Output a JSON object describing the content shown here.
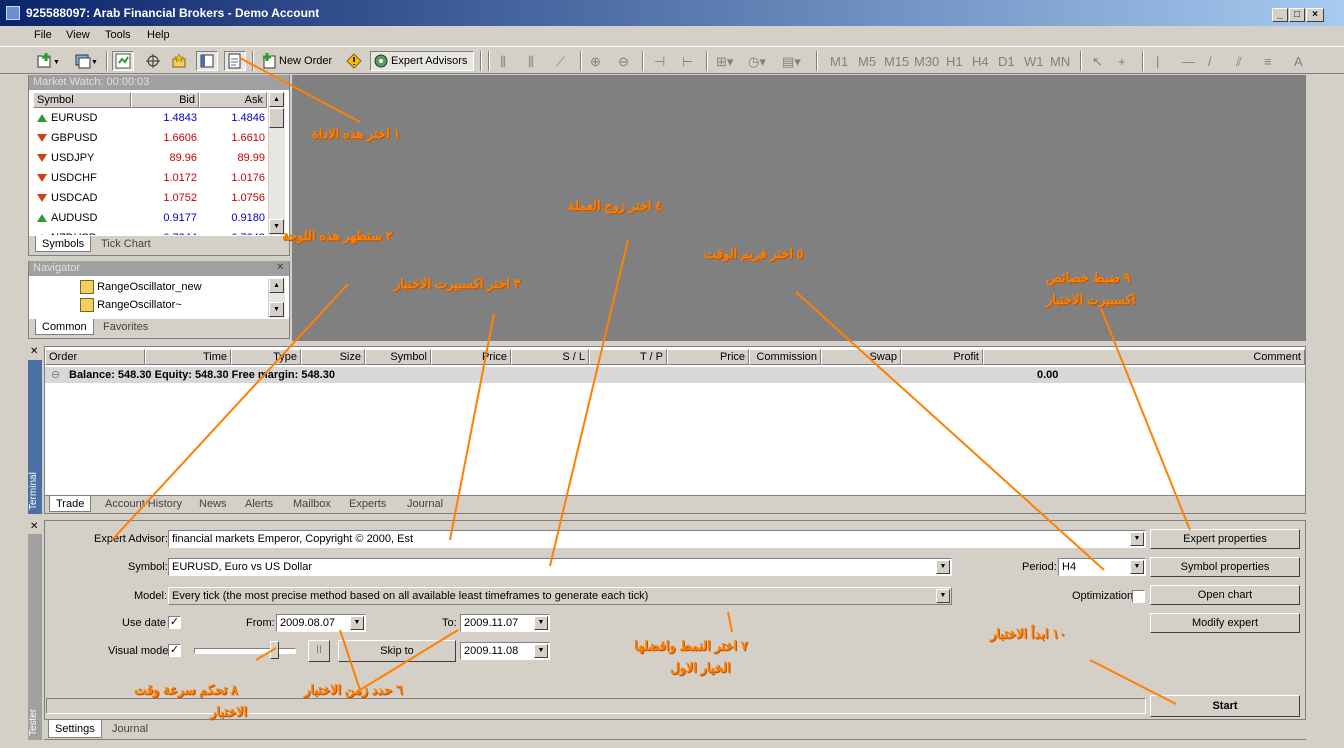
{
  "window": {
    "title": "925588097: Arab Financial Brokers - Demo Account",
    "min": "_",
    "max": "□",
    "close": "×"
  },
  "menu": [
    "File",
    "View",
    "Tools",
    "Help"
  ],
  "toolbar": {
    "new_order": "New Order",
    "expert_advisors": "Expert Advisors"
  },
  "market_watch": {
    "title": "Market Watch: 00:00:03",
    "headers": {
      "symbol": "Symbol",
      "bid": "Bid",
      "ask": "Ask"
    },
    "rows": [
      {
        "symbol": "EURUSD",
        "bid": "1.4843",
        "ask": "1.4846",
        "dir": "up"
      },
      {
        "symbol": "GBPUSD",
        "bid": "1.6606",
        "ask": "1.6610",
        "dir": "down"
      },
      {
        "symbol": "USDJPY",
        "bid": "89.96",
        "ask": "89.99",
        "dir": "down"
      },
      {
        "symbol": "USDCHF",
        "bid": "1.0172",
        "ask": "1.0176",
        "dir": "down"
      },
      {
        "symbol": "USDCAD",
        "bid": "1.0752",
        "ask": "1.0756",
        "dir": "down"
      },
      {
        "symbol": "AUDUSD",
        "bid": "0.9177",
        "ask": "0.9180",
        "dir": "up"
      },
      {
        "symbol": "NZDUSD",
        "bid": "0.7344",
        "ask": "0.7348",
        "dir": "up"
      }
    ],
    "tabs": [
      "Symbols",
      "Tick Chart"
    ]
  },
  "navigator": {
    "title": "Navigator",
    "items": [
      "RangeOscillator_new",
      "RangeOscillator~"
    ],
    "tabs": [
      "Common",
      "Favorites"
    ]
  },
  "terminal": {
    "title": "Terminal",
    "headers": [
      "Order",
      "Time",
      "Type",
      "Size",
      "Symbol",
      "Price",
      "S / L",
      "T / P",
      "Price",
      "Commission",
      "Swap",
      "Profit",
      "Comment"
    ],
    "balance_line": "Balance: 548.30  Equity: 548.30  Free margin: 548.30",
    "profit": "0.00",
    "tabs": [
      "Trade",
      "Account History",
      "News",
      "Alerts",
      "Mailbox",
      "Experts",
      "Journal"
    ]
  },
  "tester": {
    "title": "Tester",
    "expert_label": "Expert Advisor:",
    "expert_value": "financial markets Emperor, Copyright © 2000,  Est",
    "symbol_label": "Symbol:",
    "symbol_value": "EURUSD, Euro vs US Dollar",
    "model_label": "Model:",
    "model_value": "Every tick (the most precise method based on all available least timeframes to generate each tick)",
    "use_date_label": "Use date",
    "from_label": "From:",
    "from_value": "2009.08.07",
    "to_label": "To:",
    "to_value": "2009.11.07",
    "visual_label": "Visual mode",
    "pause": "II",
    "skip_to": "Skip to",
    "skip_value": "2009.11.08",
    "period_label": "Period:",
    "period_value": "H4",
    "optimization_label": "Optimization",
    "check_mark": "✓",
    "buttons": {
      "expert_properties": "Expert properties",
      "symbol_properties": "Symbol properties",
      "open_chart": "Open chart",
      "modify_expert": "Modify expert",
      "start": "Start"
    },
    "tabs": [
      "Settings",
      "Journal"
    ]
  },
  "annotations": {
    "a1": "١ اختر هذه الاداة",
    "a2": "٢ ستظهر هذه اللوحة",
    "a3": "٣ اختر اكسبيرت الاختبار",
    "a4": "٤ اختر زوج العملة",
    "a5": "٥ اختر فريم الوقت",
    "a6": "٦ حدد زمن الاختبار",
    "a7a": "٧ اختر النمط وافضلها",
    "a7b": "الخيار الاول",
    "a8a": "٨ تحكم سرعة وقت",
    "a8b": "الاختبار",
    "a9a": "٩ ضبط خصائص",
    "a9b": "اكسبيرت الاختبار",
    "a10": "١٠ ابدأ الاختبار"
  },
  "colors": {
    "bid_up": "#0000cc",
    "bid_down": "#cc0000",
    "annotation": "#ff8000"
  }
}
